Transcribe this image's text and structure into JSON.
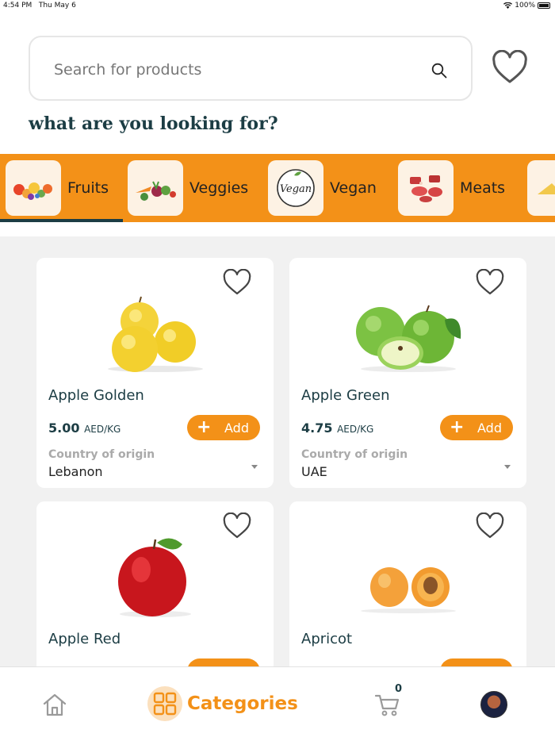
{
  "status_bar": {
    "time": "4:54 PM",
    "date": "Thu May 6",
    "battery": "100%"
  },
  "search": {
    "placeholder": "Search for products"
  },
  "heading": "what are you looking for?",
  "categories": [
    {
      "label": "Fruits",
      "icon": "fruits-icon"
    },
    {
      "label": "Veggies",
      "icon": "veggies-icon"
    },
    {
      "label": "Vegan",
      "icon": "vegan-icon",
      "badge": "Vegan"
    },
    {
      "label": "Meats",
      "icon": "meats-icon"
    }
  ],
  "products": [
    {
      "name": "Apple Golden",
      "price": "5.00",
      "unit": "AED/KG",
      "add_label": "Add",
      "origin_label": "Country of origin",
      "origin": "Lebanon",
      "icon": "golden-apple-image"
    },
    {
      "name": "Apple Green",
      "price": "4.75",
      "unit": "AED/KG",
      "add_label": "Add",
      "origin_label": "Country of origin",
      "origin": "UAE",
      "icon": "green-apple-image"
    },
    {
      "name": "Apple Red",
      "icon": "red-apple-image"
    },
    {
      "name": "Apricot",
      "icon": "apricot-image"
    }
  ],
  "bottom_nav": {
    "categories_label": "Categories",
    "cart_count": "0"
  },
  "colors": {
    "accent": "#f39118",
    "dark": "#1c3d44",
    "background": "#f1f1f1"
  }
}
